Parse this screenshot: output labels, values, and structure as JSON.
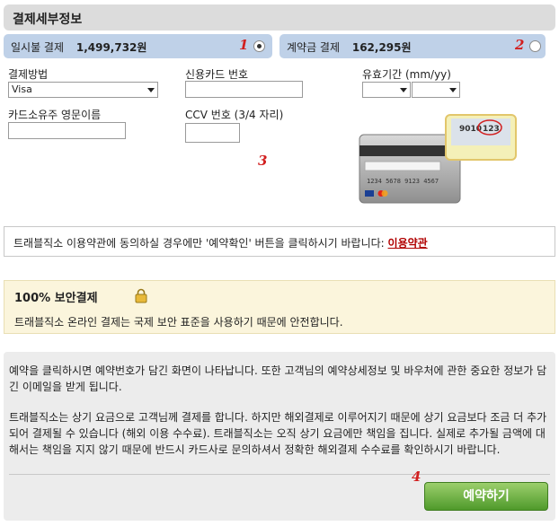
{
  "header": {
    "title": "결제세부정보"
  },
  "payment_options": [
    {
      "label": "일시불 결제",
      "amount": "1,499,732원",
      "marker": "1",
      "selected": true
    },
    {
      "label": "계약금 결제",
      "amount": "162,295원",
      "marker": "2",
      "selected": false
    }
  ],
  "form": {
    "payment_method_label": "결제방법",
    "payment_method_value": "Visa",
    "card_number_label": "신용카드 번호",
    "expiry_label": "유효기간 (mm/yy)",
    "holder_label": "카드소유주 영문이름",
    "ccv_label": "CCV 번호 (3/4 자리)",
    "marker": "3"
  },
  "card_image": {
    "number_front": "9010",
    "ccv": "123",
    "number_back": "1234 5678 9123 4567"
  },
  "terms": {
    "text": "트래블직소 이용약관에 동의하실 경우에만 '예약확인' 버튼을 클릭하시기 바랍니다:",
    "link": "이용약관"
  },
  "secure": {
    "title": "100% 보안결제",
    "description": "트래블직소 온라인 결제는 국제 보안 표준을 사용하기 때문에 안전합니다."
  },
  "info": {
    "paragraph1": "예약을 클릭하시면 예약번호가 담긴 화면이 나타납니다. 또한 고객님의 예약상세정보 및 바우처에 관한 중요한 정보가 담긴 이메일을 받게 됩니다.",
    "paragraph2": "트래블직소는 상기 요금으로 고객님께 결제를 합니다. 하지만 해외결제로 이루어지기 때문에 상기 요금보다 조금 더 추가되어 결제될 수 있습니다 (해외 이용 수수료). 트래블직소는 오직 상기 요금에만 책임을 집니다. 실제로 추가될 금액에 대해서는 책임을 지지 않기 때문에 반드시 카드사로 문의하셔서 정확한 해외결제 수수료를 확인하시기 바랍니다."
  },
  "book_button": {
    "label": "예약하기",
    "marker": "4"
  },
  "colors": {
    "option_bg": "#bfd1e8",
    "marker_red": "#d21f1f",
    "button_green": "#5aa531",
    "secure_bg": "#fbf5dc"
  }
}
